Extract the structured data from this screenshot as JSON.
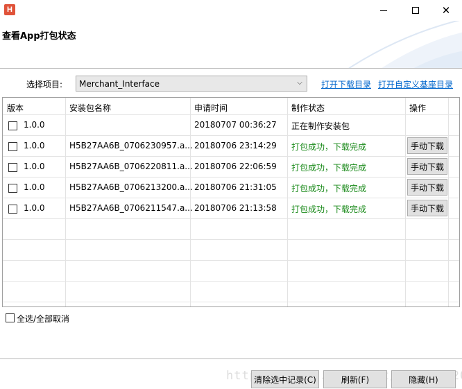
{
  "window": {
    "app_icon_letter": "H"
  },
  "header": {
    "title": "查看App打包状态"
  },
  "project": {
    "label": "选择项目:",
    "selected": "Merchant_Interface",
    "link_open_download": "打开下载目录",
    "link_open_custom_base": "打开自定义基座目录"
  },
  "table": {
    "headers": [
      "版本",
      "安装包名称",
      "申请时间",
      "制作状态",
      "操作"
    ],
    "rows": [
      {
        "version": "1.0.0",
        "name": "",
        "time": "20180707 00:36:27",
        "status": "正在制作安装包",
        "action": ""
      },
      {
        "version": "1.0.0",
        "name": "H5B27AA6B_0706230957.a...",
        "time": "20180706 23:14:29",
        "status": "打包成功，下载完成",
        "action": "手动下载"
      },
      {
        "version": "1.0.0",
        "name": "H5B27AA6B_0706220811.a...",
        "time": "20180706 22:06:59",
        "status": "打包成功，下载完成",
        "action": "手动下载"
      },
      {
        "version": "1.0.0",
        "name": "H5B27AA6B_0706213200.a...",
        "time": "20180706 21:31:05",
        "status": "打包成功，下载完成",
        "action": "手动下载"
      },
      {
        "version": "1.0.0",
        "name": "H5B27AA6B_0706211547.a...",
        "time": "20180706 21:13:58",
        "status": "打包成功，下载完成",
        "action": "手动下载"
      }
    ]
  },
  "footer": {
    "select_all_label": "全选/全部取消",
    "clear_selected": "清除选中记录(C)",
    "refresh": "刷新(F)",
    "hide": "隐藏(H)"
  },
  "watermark": "https://blog.csdn.net/qq_40052018"
}
